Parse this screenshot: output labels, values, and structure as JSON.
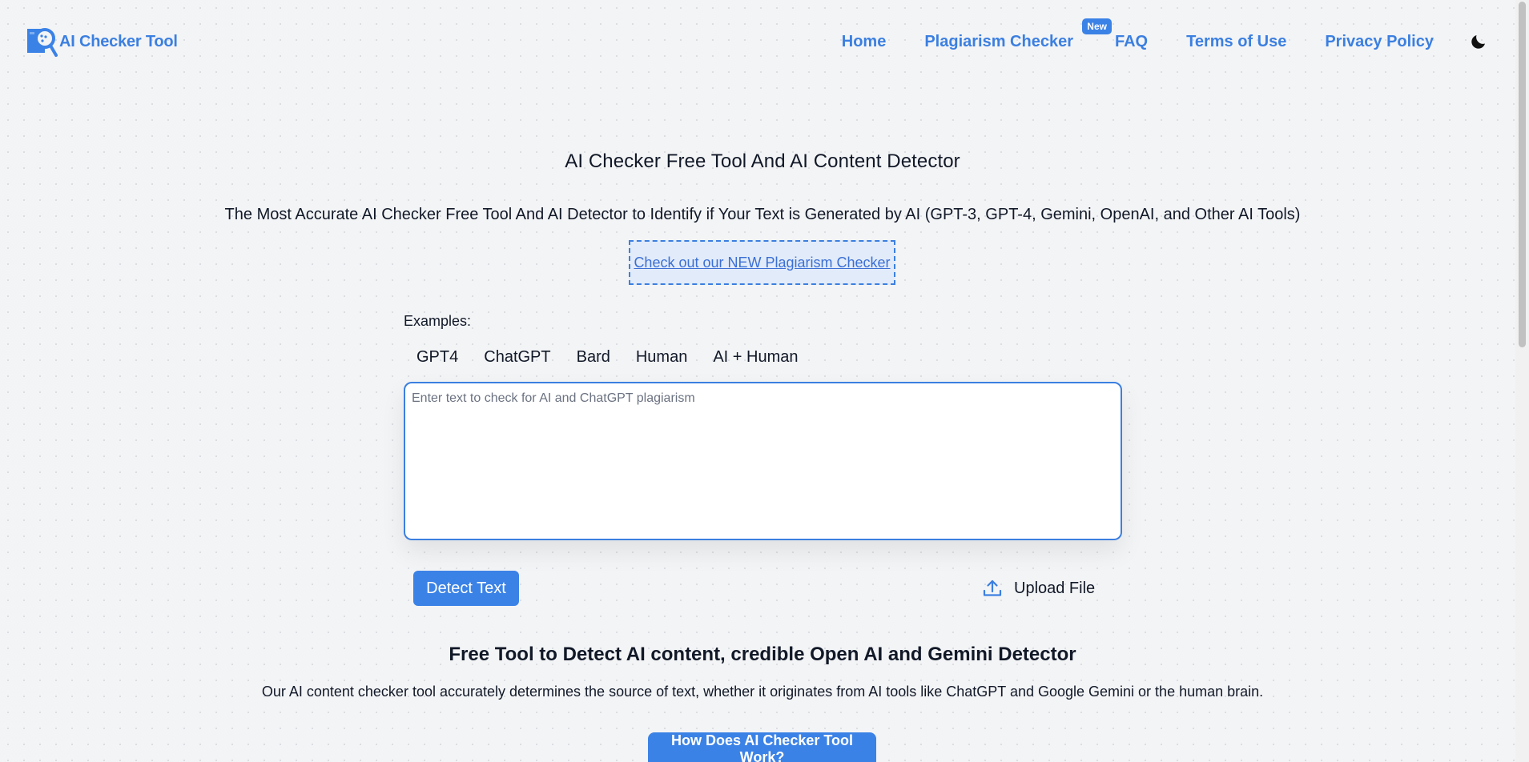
{
  "header": {
    "brand_name": "AI Checker Tool",
    "nav": {
      "home": "Home",
      "plagiarism": "Plagiarism Checker",
      "plagiarism_badge": "New",
      "faq": "FAQ",
      "terms": "Terms of Use",
      "privacy": "Privacy Policy"
    },
    "theme_icon": "moon-icon"
  },
  "hero": {
    "title": "AI Checker Free Tool And AI Content Detector",
    "subtitle": "The Most Accurate AI Checker Free Tool And AI Detector to Identify if Your Text is Generated by AI (GPT-3, GPT-4, Gemini, OpenAI, and Other AI Tools)",
    "promo_link": "Check out our NEW Plagiarism Checker"
  },
  "examples": {
    "label": "Examples:",
    "items": [
      "GPT4",
      "ChatGPT",
      "Bard",
      "Human",
      "AI + Human"
    ]
  },
  "editor": {
    "value": "",
    "placeholder": "Enter text to check for AI and ChatGPT plagiarism"
  },
  "actions": {
    "detect_label": "Detect Text",
    "upload_label": "Upload File",
    "upload_icon": "upload-icon"
  },
  "info": {
    "title": "Free Tool to Detect AI content, credible Open AI and Gemini Detector",
    "text": "Our AI content checker tool accurately determines the source of text, whether it originates from AI tools like ChatGPT and Google Gemini or the human brain.",
    "how_button": "How Does AI Checker Tool Work?"
  },
  "colors": {
    "accent": "#3b7fe0",
    "button": "#3b82e6",
    "background": "#f3f4f6"
  }
}
